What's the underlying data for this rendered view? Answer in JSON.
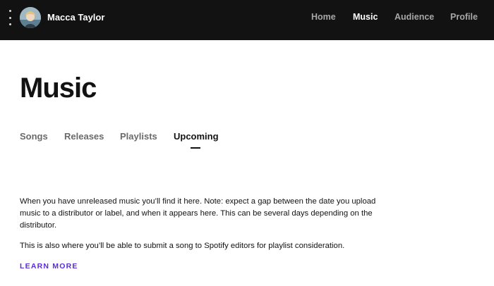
{
  "header": {
    "artist_name": "Macca Taylor",
    "nav": [
      {
        "label": "Home",
        "active": false
      },
      {
        "label": "Music",
        "active": true
      },
      {
        "label": "Audience",
        "active": false
      },
      {
        "label": "Profile",
        "active": false
      }
    ],
    "menu_icon": "kebab-menu-icon",
    "avatar_icon": "artist-avatar"
  },
  "page": {
    "title": "Music",
    "tabs": [
      {
        "label": "Songs",
        "active": false
      },
      {
        "label": "Releases",
        "active": false
      },
      {
        "label": "Playlists",
        "active": false
      },
      {
        "label": "Upcoming",
        "active": true
      }
    ]
  },
  "content": {
    "paragraph1": "When you have unreleased music you’ll find it here. Note: expect a gap between the date you upload music to a distributor or label, and when it appears here. This can be several days depending on the distributor.",
    "paragraph2": "This is also where you’ll be able to submit a song to Spotify editors for playlist consideration.",
    "learn_more": "LEARN MORE"
  },
  "colors": {
    "topbar_bg": "#121212",
    "link_accent": "#5a2be0",
    "text_primary": "#121212",
    "text_muted": "#6a6a6a"
  }
}
